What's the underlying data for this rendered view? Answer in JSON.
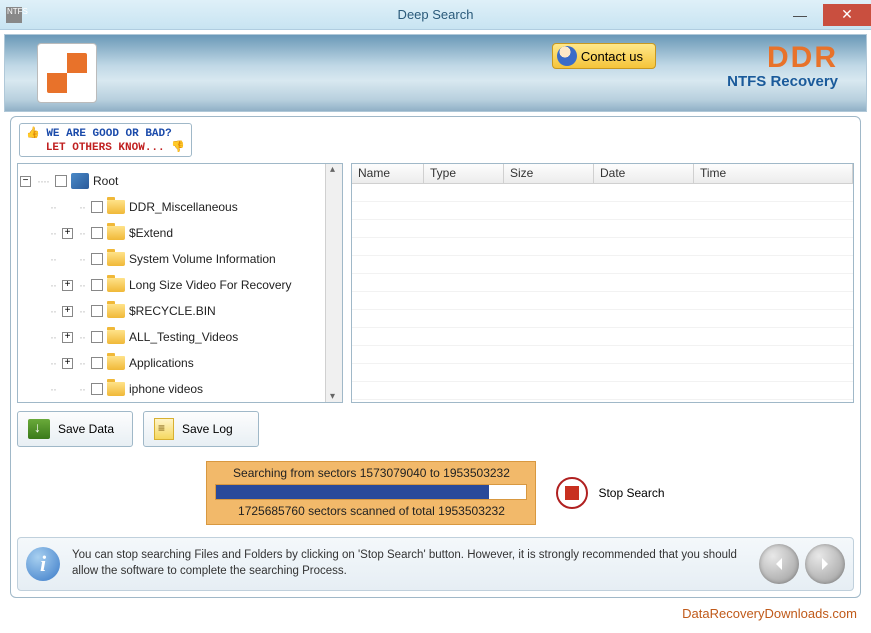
{
  "window": {
    "title": "Deep Search"
  },
  "banner": {
    "contact_label": "Contact us",
    "brand": "DDR",
    "brand_sub": "NTFS Recovery"
  },
  "feedback": {
    "line1": "WE ARE GOOD OR BAD?",
    "line2": "LET OTHERS KNOW..."
  },
  "tree": {
    "root": "Root",
    "items": [
      {
        "label": "DDR_Miscellaneous",
        "expandable": false
      },
      {
        "label": "$Extend",
        "expandable": true
      },
      {
        "label": "System Volume Information",
        "expandable": false
      },
      {
        "label": "Long Size Video For Recovery",
        "expandable": true
      },
      {
        "label": "$RECYCLE.BIN",
        "expandable": true
      },
      {
        "label": "ALL_Testing_Videos",
        "expandable": true
      },
      {
        "label": "Applications",
        "expandable": true
      },
      {
        "label": "iphone videos",
        "expandable": false
      }
    ]
  },
  "grid": {
    "columns": {
      "name": "Name",
      "type": "Type",
      "size": "Size",
      "date": "Date",
      "time": "Time"
    }
  },
  "actions": {
    "save_data": "Save Data",
    "save_log": "Save Log"
  },
  "progress": {
    "searching_text": "Searching from sectors  1573079040 to 1953503232",
    "scanned_text": "1725685760 sectors scanned of total 1953503232",
    "fill_percent": 88,
    "stop_label": "Stop Search"
  },
  "info": {
    "text": "You can stop searching Files and Folders by clicking on 'Stop Search' button. However, it is strongly recommended that you should allow the software to complete the searching Process."
  },
  "footer_link": "DataRecoveryDownloads.com"
}
